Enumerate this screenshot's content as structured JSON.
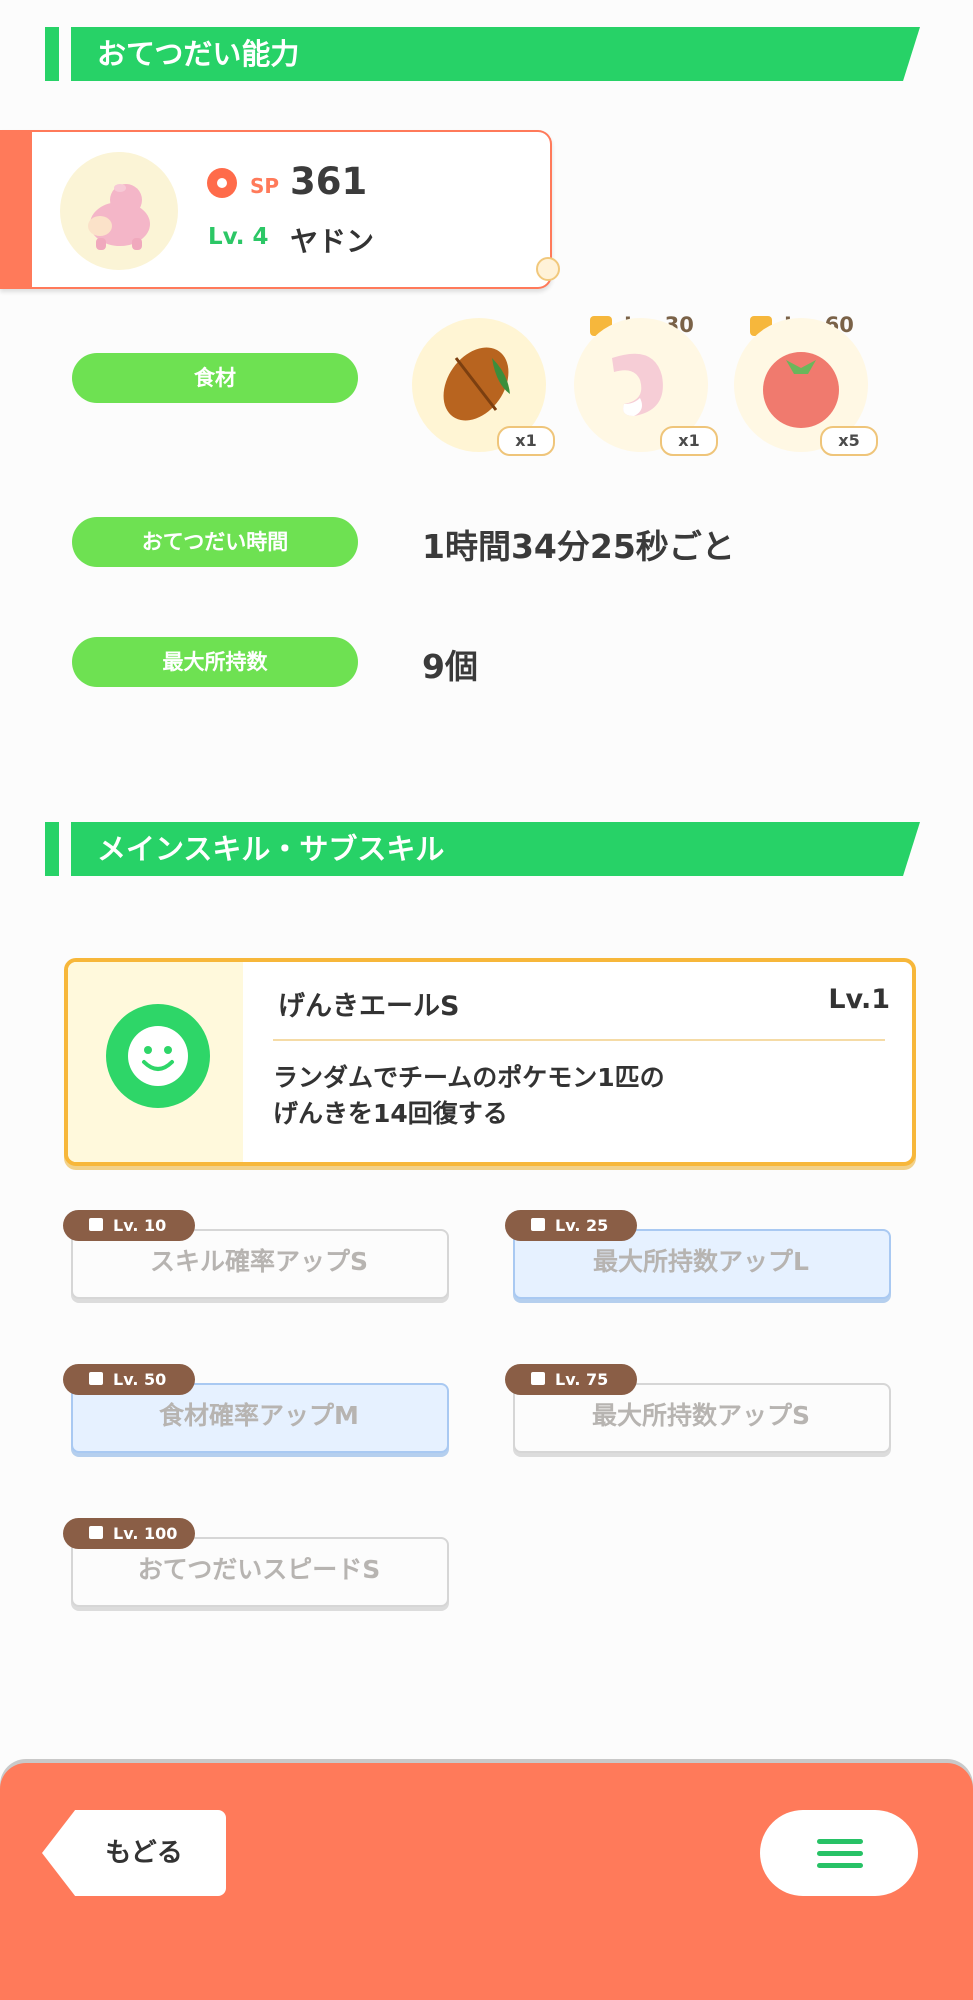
{
  "section_ability": {
    "title": "おてつだい能力"
  },
  "pokemon": {
    "sp_label": "SP",
    "sp_value": "361",
    "level_label": "Lv. 4",
    "name": "ヤドン"
  },
  "ingredients": {
    "label": "食材",
    "items": [
      {
        "icon": "cacao-icon",
        "qty": "x1",
        "unlock": ""
      },
      {
        "icon": "slowpoke-tail-icon",
        "qty": "x1",
        "unlock": "Lv. 30"
      },
      {
        "icon": "tomato-icon",
        "qty": "x5",
        "unlock": "Lv. 60"
      }
    ]
  },
  "help_time": {
    "label": "おてつだい時間",
    "value": "1時間34分25秒ごと"
  },
  "max_carry": {
    "label": "最大所持数",
    "value": "9個"
  },
  "section_skill": {
    "title": "メインスキル・サブスキル"
  },
  "main_skill": {
    "name": "げんきエールS",
    "level": "Lv.1",
    "desc_line1": "ランダムでチームのポケモン1匹の",
    "desc_line2": "げんきを14回復する",
    "icon": "smile-icon"
  },
  "sub_skills": [
    {
      "unlock": "Lv. 10",
      "name": "スキル確率アップS",
      "tint": "white"
    },
    {
      "unlock": "Lv. 25",
      "name": "最大所持数アップL",
      "tint": "blue"
    },
    {
      "unlock": "Lv. 50",
      "name": "食材確率アップM",
      "tint": "blue"
    },
    {
      "unlock": "Lv. 75",
      "name": "最大所持数アップS",
      "tint": "white"
    },
    {
      "unlock": "Lv. 100",
      "name": "おてつだいスピードS",
      "tint": "white"
    }
  ],
  "footer": {
    "back_label": "もどる",
    "menu_icon": "hamburger-menu-icon"
  },
  "colors": {
    "accent_green": "#27d267",
    "pill_green": "#6ee152",
    "footer_orange": "#ff7a5a",
    "lock_brown": "#8a5e46"
  }
}
